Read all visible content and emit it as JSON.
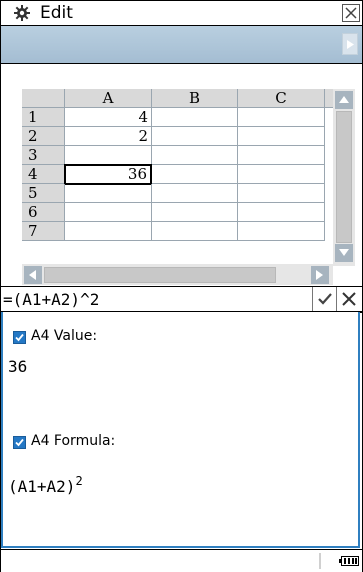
{
  "titlebar": {
    "title": "Edit",
    "settings_icon": "gear-icon",
    "close_icon": "close-icon"
  },
  "spreadsheet": {
    "column_headers": [
      "A",
      "B",
      "C"
    ],
    "rows": [
      {
        "row": "1",
        "cells": [
          "4",
          "",
          ""
        ]
      },
      {
        "row": "2",
        "cells": [
          "2",
          "",
          ""
        ]
      },
      {
        "row": "3",
        "cells": [
          "",
          "",
          ""
        ]
      },
      {
        "row": "4",
        "cells": [
          "36",
          "",
          ""
        ]
      },
      {
        "row": "5",
        "cells": [
          "",
          "",
          ""
        ]
      },
      {
        "row": "6",
        "cells": [
          "",
          "",
          ""
        ]
      },
      {
        "row": "7",
        "cells": [
          "",
          "",
          ""
        ]
      }
    ],
    "selected_cell": "A4"
  },
  "formula_bar": {
    "value": "=(A1+A2)^2",
    "confirm_icon": "checkmark-icon",
    "cancel_icon": "close-icon"
  },
  "monitor": {
    "value_label": "A4 Value:",
    "value": "36",
    "formula_label": "A4 Formula:",
    "formula_base": "(A1+A2)",
    "formula_exponent": "2",
    "value_checked": true,
    "formula_checked": true
  },
  "status": {
    "battery_icon": "battery-icon"
  },
  "colors": {
    "accent": "#2478c5",
    "toolbar": "#b0c7da",
    "header": "#d9d9d9"
  }
}
